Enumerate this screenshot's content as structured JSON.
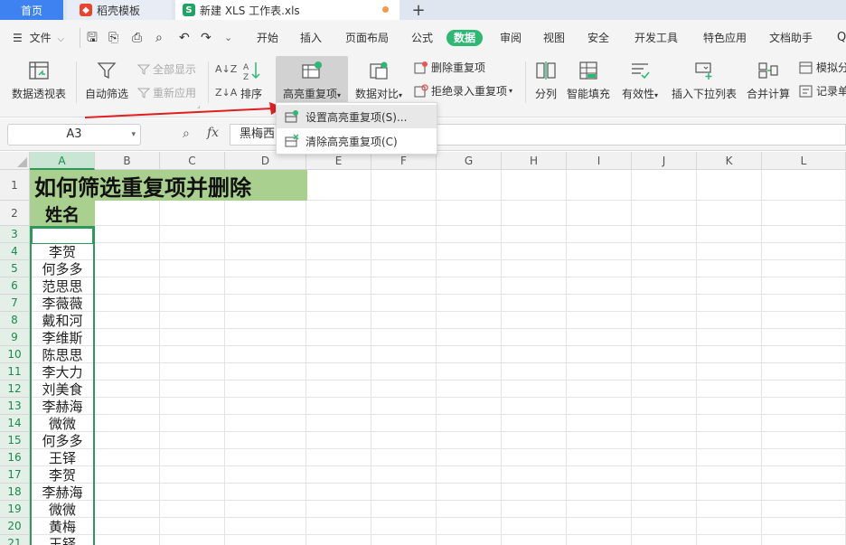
{
  "tabs": {
    "home": "首页",
    "template": "稻壳模板",
    "document": "新建 XLS 工作表.xls",
    "add": "+"
  },
  "menu": {
    "file": "文件",
    "items": [
      "开始",
      "插入",
      "页面布局",
      "公式",
      "数据",
      "审阅",
      "视图",
      "安全",
      "开发工具",
      "特色应用",
      "文档助手"
    ],
    "active": "数据"
  },
  "ribbon": {
    "pivot": "数据透视表",
    "autofilter": "自动筛选",
    "show_all": "全部显示",
    "reapply": "重新应用",
    "sort": "排序",
    "highlight_dup": "高亮重复项",
    "compare": "数据对比",
    "delete_dup": "删除重复项",
    "reject_dup": "拒绝录入重复项",
    "split": "分列",
    "smart_fill": "智能填充",
    "validity": "有效性",
    "insert_dropdown": "插入下拉列表",
    "consolidate": "合并计算",
    "simulate": "模拟分",
    "record": "记录单"
  },
  "dropdown": {
    "set": "设置高亮重复项(S)...",
    "clear": "清除高亮重复项(C)"
  },
  "formula": {
    "namebox": "A3",
    "fx": "fx",
    "value": "黑梅西"
  },
  "sheet": {
    "columns": [
      "A",
      "B",
      "C",
      "D",
      "E",
      "F",
      "G",
      "H",
      "I",
      "J",
      "K",
      "L"
    ],
    "rows": [
      "1",
      "2",
      "3",
      "4",
      "5",
      "6",
      "7",
      "8",
      "9",
      "10",
      "11",
      "12",
      "13",
      "14",
      "15",
      "16",
      "17",
      "18",
      "19",
      "20",
      "21"
    ],
    "title": "如何筛选重复项并删除",
    "header": "姓名",
    "names": [
      "黑梅西",
      "李贺",
      "何多多",
      "范思思",
      "李薇薇",
      "戴和河",
      "李维斯",
      "陈思思",
      "李大力",
      "刘美食",
      "李赫海",
      "微微",
      "何多多",
      "王铎",
      "李贺",
      "李赫海",
      "微微",
      "黄梅",
      "王铎"
    ]
  },
  "colors": {
    "accent": "#2db873",
    "header_fill": "#a9d08e",
    "selection": "#2d9a5a",
    "arrow": "#e02020"
  }
}
